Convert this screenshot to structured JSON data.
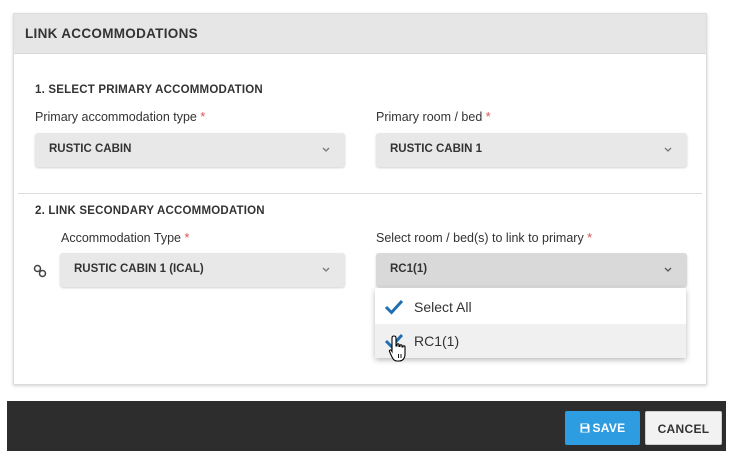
{
  "dialog": {
    "title": "LINK ACCOMMODATIONS",
    "section1": {
      "title": "1. SELECT PRIMARY ACCOMMODATION",
      "type_label": "Primary accommodation type",
      "type_value": "RUSTIC CABIN",
      "room_label": "Primary room / bed",
      "room_value": "RUSTIC CABIN 1"
    },
    "section2": {
      "title": "2. LINK SECONDARY ACCOMMODATION",
      "type_label": "Accommodation Type",
      "type_value": "RUSTIC CABIN 1 (ICAL)",
      "rooms_label": "Select room / bed(s) to link to primary",
      "rooms_value": "RC1(1)",
      "options": [
        {
          "label": "Select All",
          "checked": true
        },
        {
          "label": "RC1(1)",
          "checked": true
        }
      ]
    },
    "required_mark": "*",
    "icons": {
      "chevron": "chevron-down-icon",
      "link": "link-icon",
      "check": "checkmark-icon",
      "save": "floppy-disk-icon",
      "cursor": "hand-pointer-cursor"
    }
  },
  "footer": {
    "save_label": "SAVE",
    "cancel_label": "CANCEL"
  },
  "colors": {
    "accent": "#2d9ce0",
    "check": "#1f6fb2",
    "required": "#d9534f",
    "footer_bg": "#2d2d2d"
  }
}
